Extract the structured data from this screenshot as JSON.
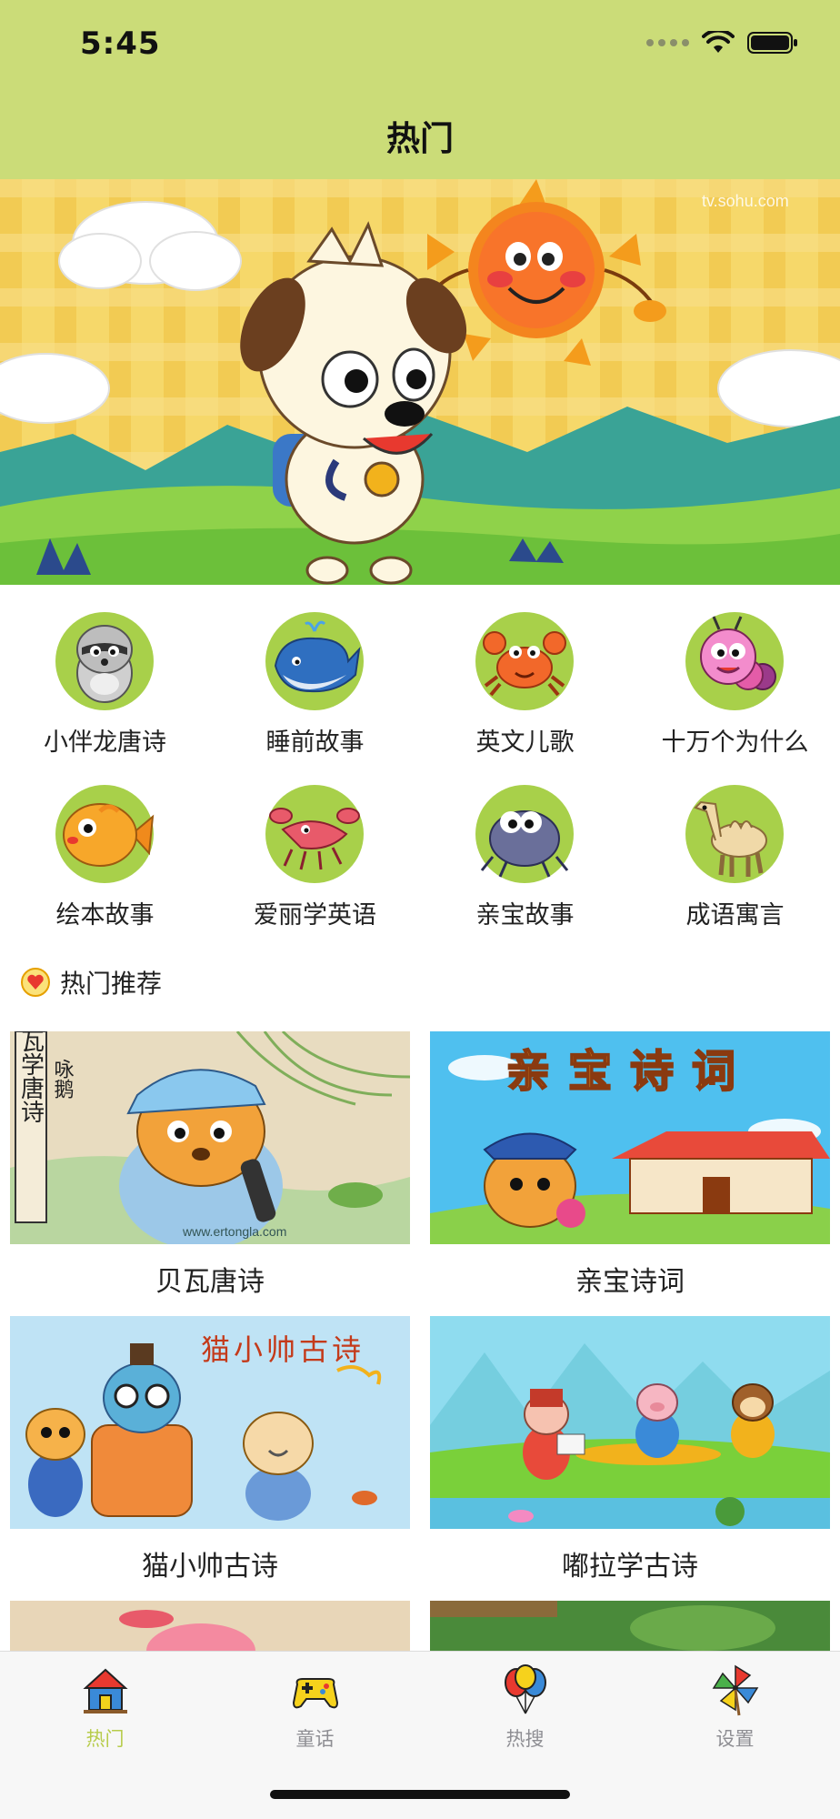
{
  "status_bar": {
    "time": "5:45"
  },
  "nav": {
    "title": "热门"
  },
  "banner": {
    "watermark": "tv.sohu.com"
  },
  "categories": [
    {
      "label": "小伴龙唐诗",
      "icon": "raccoon-icon"
    },
    {
      "label": "睡前故事",
      "icon": "whale-icon"
    },
    {
      "label": "英文儿歌",
      "icon": "crab-icon"
    },
    {
      "label": "十万个为什么",
      "icon": "caterpillar-icon"
    },
    {
      "label": "绘本故事",
      "icon": "goldfish-icon"
    },
    {
      "label": "爱丽学英语",
      "icon": "lobster-icon"
    },
    {
      "label": "亲宝故事",
      "icon": "beetle-icon"
    },
    {
      "label": "成语寓言",
      "icon": "camel-icon"
    }
  ],
  "section": {
    "title": "热门推荐",
    "icon": "heart-badge-icon"
  },
  "cards": [
    {
      "label": "贝瓦唐诗",
      "thumb_text_vertical": "贝瓦学唐诗",
      "thumb_text_side": "咏鹅",
      "thumb_site": "www.ertongla.com"
    },
    {
      "label": "亲宝诗词",
      "thumb_text": "亲宝诗词"
    },
    {
      "label": "猫小帅古诗",
      "thumb_text": "猫小帅古诗"
    },
    {
      "label": "嘟拉学古诗"
    }
  ],
  "tabs": [
    {
      "label": "热门",
      "icon": "house-icon",
      "active": true
    },
    {
      "label": "童话",
      "icon": "gamepad-icon",
      "active": false
    },
    {
      "label": "热搜",
      "icon": "balloons-icon",
      "active": false
    },
    {
      "label": "设置",
      "icon": "pinwheel-icon",
      "active": false
    }
  ],
  "colors": {
    "nav_bg": "#cbdc78",
    "tab_active": "#b7cc4b",
    "tab_inactive": "#8e8e93"
  }
}
